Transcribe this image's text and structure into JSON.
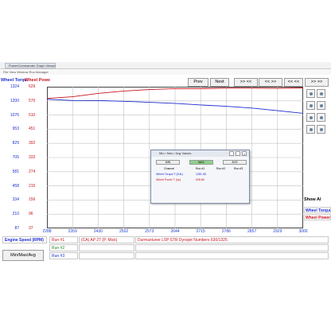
{
  "window": {
    "title_tab": "PowerCommander Graph Viewer",
    "menu": "File   View   Window   Run Manager"
  },
  "header": {
    "wheel_torque_label": "Wheel Torqu",
    "wheel_power_label": "Wheel Powe",
    "prev_label": "Prev",
    "next_label": "Next",
    "nav_buttons": [
      ">> <<",
      "<< >>",
      "<< <<",
      ">> >>"
    ]
  },
  "axes": {
    "torque_ticks": [
      "1324",
      "1200",
      "1076",
      "953",
      "829",
      "705",
      "581",
      "458",
      "334",
      "210",
      "87"
    ],
    "power_ticks": [
      "629",
      "570",
      "510",
      "451",
      "392",
      "333",
      "274",
      "215",
      "156",
      "96",
      "37"
    ],
    "x_ticks": [
      "2288",
      "2359",
      "2430",
      "2502",
      "2573",
      "2644",
      "2715",
      "2786",
      "2857",
      "2929",
      "3000"
    ]
  },
  "colors": {
    "torque": "#1a2bd0",
    "power": "#c8141e",
    "grid": "#c0c0c0",
    "x_axis": "#1a3bcf"
  },
  "chart_data": {
    "type": "line",
    "x": [
      2288,
      2359,
      2430,
      2502,
      2573,
      2644,
      2715,
      2786,
      2857,
      2929,
      3000
    ],
    "xlim": [
      2288,
      3000
    ],
    "series": [
      {
        "name": "Wheel Torque",
        "axis": "left",
        "values": [
          1215,
          1204,
          1203,
          1197,
          1188,
          1179,
          1165,
          1153,
          1138,
          1115,
          1092
        ],
        "ylim": [
          87,
          1324
        ]
      },
      {
        "name": "Wheel Power",
        "axis": "right",
        "values": [
          580,
          587,
          601,
          611,
          617,
          621,
          621,
          623,
          623,
          622,
          624
        ],
        "ylim": [
          37,
          629
        ]
      }
    ],
    "grid": true
  },
  "side": {
    "show_label": "Show Al",
    "legend_torque": "Wheel Torque",
    "legend_power": "Wheel Power T"
  },
  "dialog": {
    "title": "Min / Max / Avg Values",
    "tabs": [
      "MIN",
      "MAX",
      "AVG"
    ],
    "channel_header": "Channel",
    "col1": "Run #1",
    "col2": "Run #2",
    "col3": "Run #3",
    "rows": [
      {
        "name": "Wheel Torque T (ft-lb)",
        "value": "1281.98"
      },
      {
        "name": "Wheel Power T (hp)",
        "value": "628.86"
      }
    ]
  },
  "bottom": {
    "engine_speed": "Engine Speed (RPM)",
    "minmax_button": "Min/Max/Avg",
    "runs": [
      {
        "label": "Run #1",
        "value": "(CA) AP 27 (P. Mick)",
        "note": "Durmaxtuner L5P STR Dynojet Numbers 630/1325"
      },
      {
        "label": "Run #2",
        "value": "",
        "note": ""
      },
      {
        "label": "Run #3",
        "value": "",
        "note": ""
      }
    ]
  }
}
